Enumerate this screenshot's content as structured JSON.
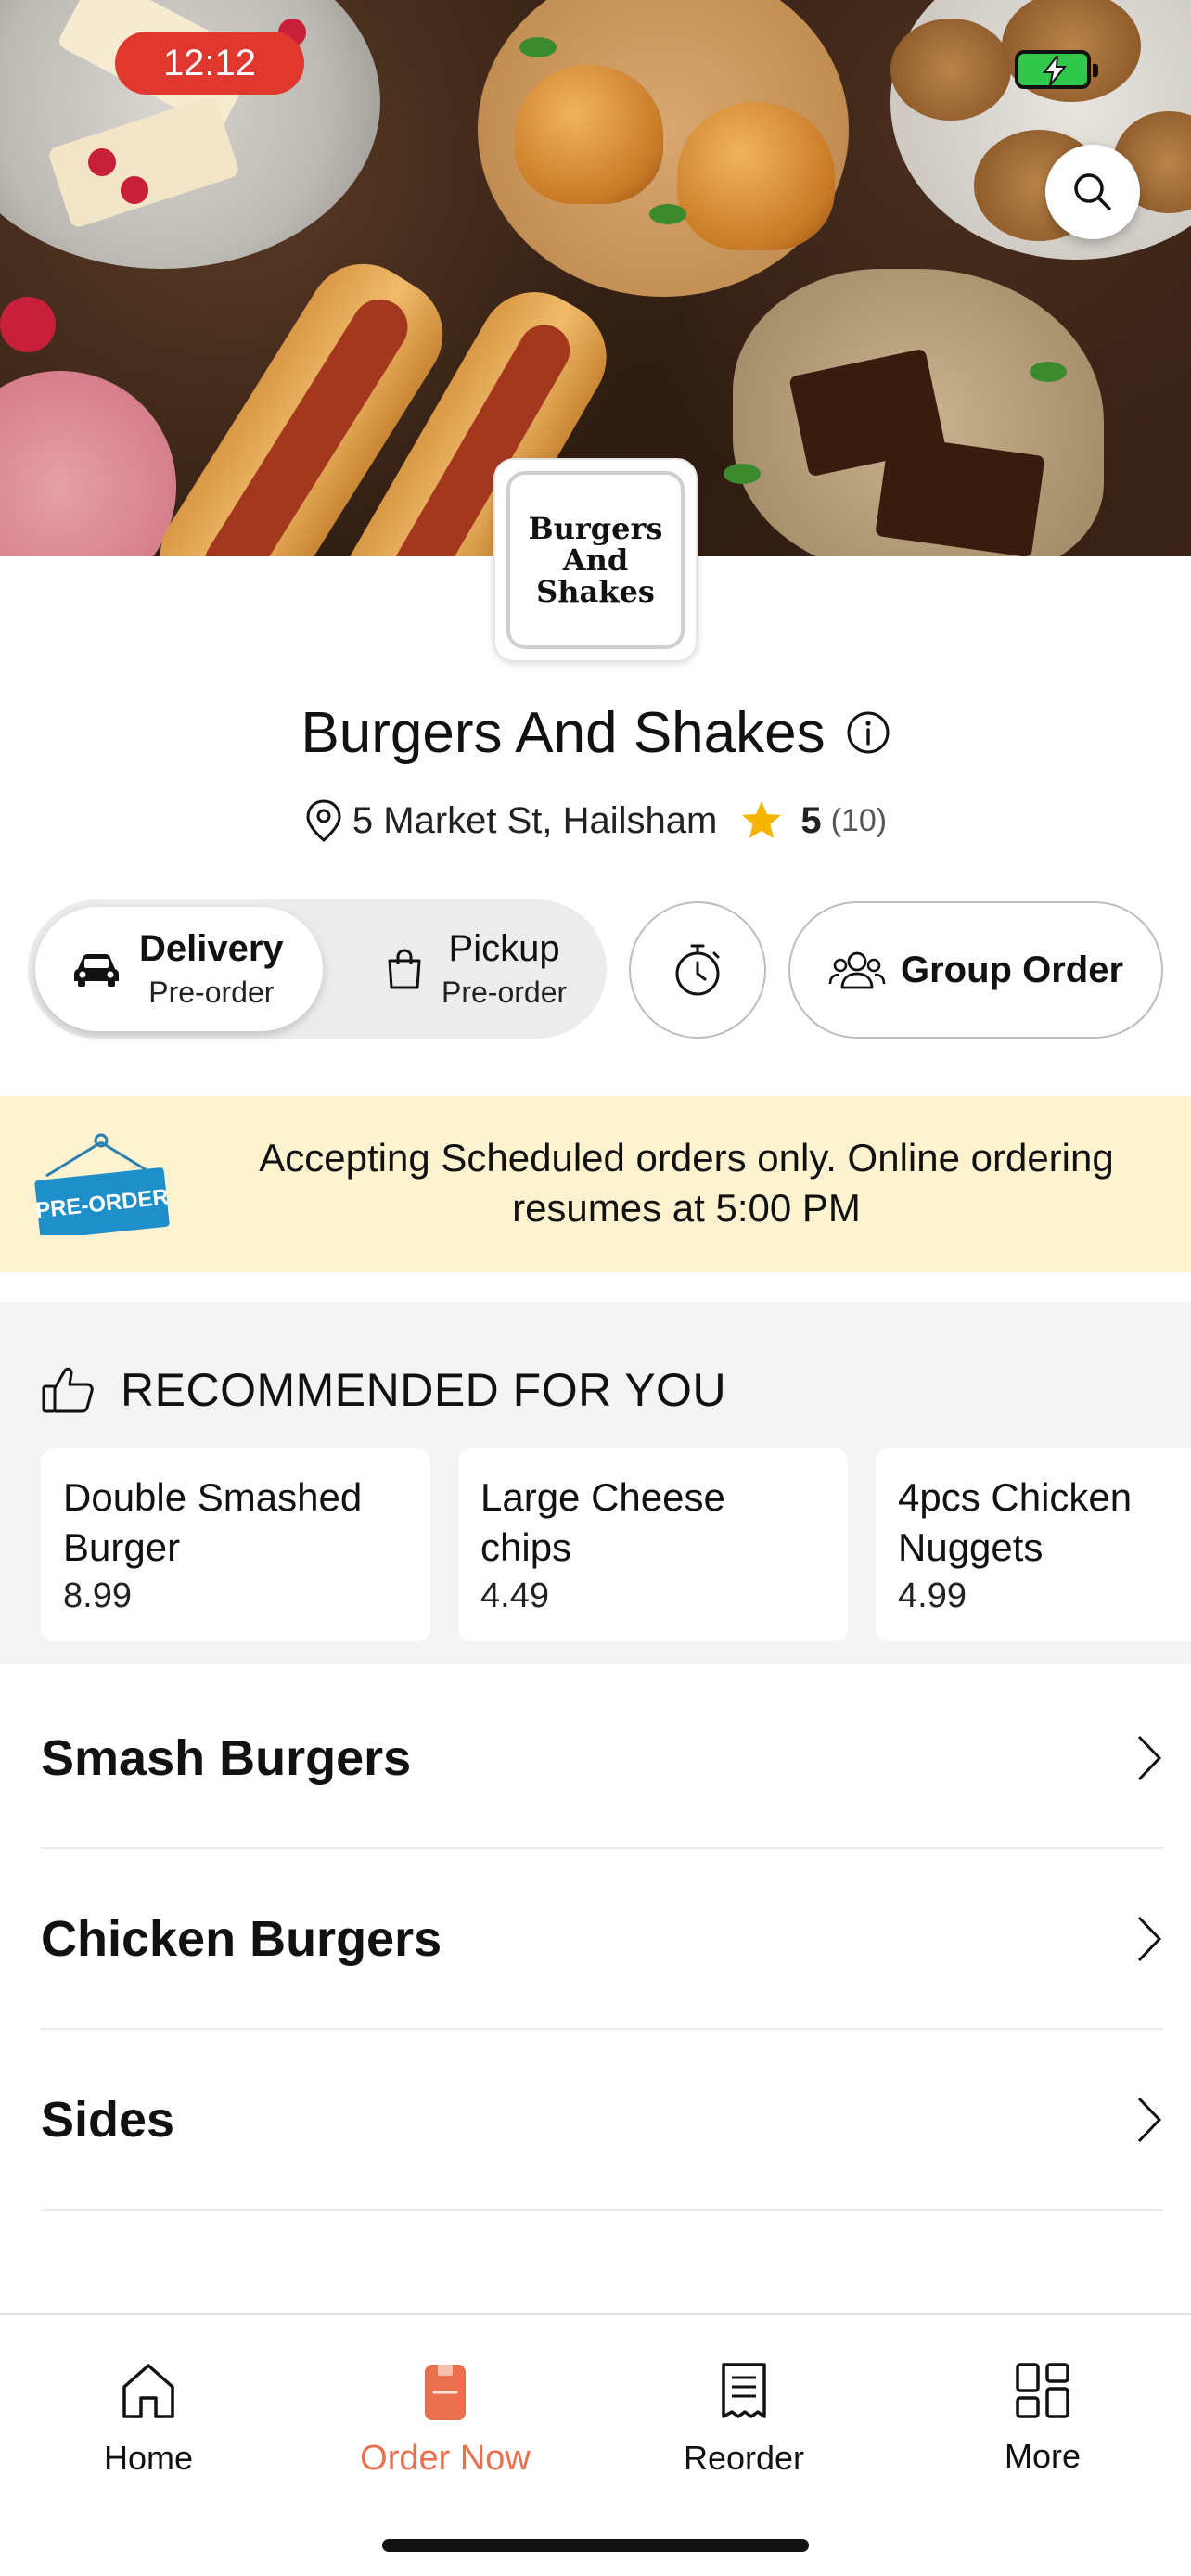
{
  "status_bar": {
    "time": "12:12"
  },
  "restaurant": {
    "logo_lines": [
      "Burgers",
      "And",
      "Shakes"
    ],
    "name": "Burgers And Shakes",
    "address": "5 Market St, Hailsham",
    "rating": "5",
    "rating_count": "(10)"
  },
  "order_modes": {
    "delivery": {
      "label": "Delivery",
      "sub": "Pre-order",
      "selected": true
    },
    "pickup": {
      "label": "Pickup",
      "sub": "Pre-order",
      "selected": false
    }
  },
  "group_order_label": "Group Order",
  "banner": {
    "sign_text": "PRE-ORDER",
    "message": "Accepting Scheduled orders only. Online ordering resumes at 5:00 PM"
  },
  "recommended": {
    "title": "RECOMMENDED FOR YOU",
    "items": [
      {
        "name": "Double Smashed Burger",
        "price": "8.99"
      },
      {
        "name": "Large Cheese chips",
        "price": "4.49"
      },
      {
        "name": "4pcs Chicken Nuggets",
        "price": "4.99"
      }
    ]
  },
  "categories": [
    {
      "label": "Smash Burgers"
    },
    {
      "label": "Chicken Burgers"
    },
    {
      "label": "Sides"
    }
  ],
  "bottom_nav": [
    {
      "label": "Home",
      "icon": "home-icon",
      "active": false
    },
    {
      "label": "Order Now",
      "icon": "order-icon",
      "active": true
    },
    {
      "label": "Reorder",
      "icon": "receipt-icon",
      "active": false
    },
    {
      "label": "More",
      "icon": "grid-icon",
      "active": false
    }
  ],
  "colors": {
    "accent": "#e8704e",
    "time_pill": "#e0372f",
    "banner_bg": "#fdf3d1",
    "star": "#f5b400",
    "preorder_sign": "#1f8fc9"
  }
}
